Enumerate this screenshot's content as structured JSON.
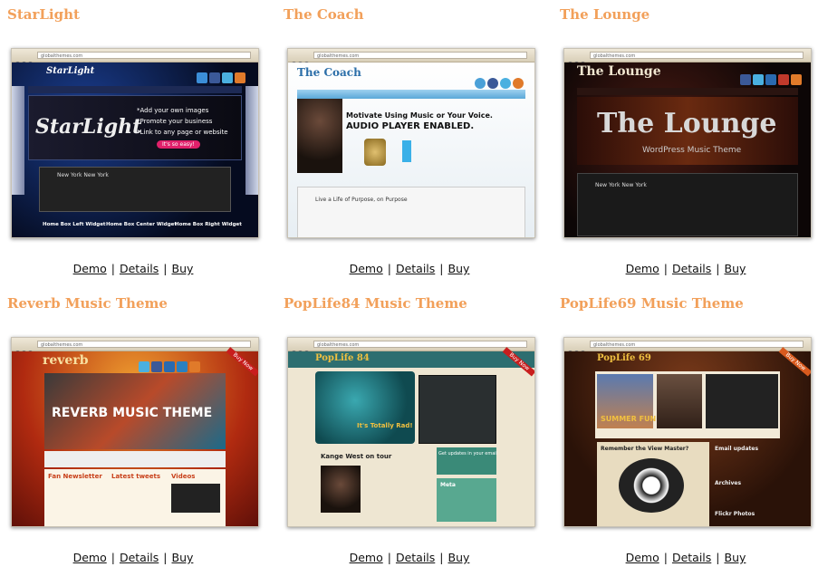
{
  "themes": [
    {
      "title": "StarLight",
      "url": "globalthemes.com",
      "demo": "Demo",
      "details": "Details",
      "buy": "Buy",
      "shot": {
        "logo": "StarLight",
        "lines": [
          "*Add your own images",
          "*Promote your business",
          "*Link to any page or website"
        ],
        "button": "It's so easy!",
        "widgets": [
          "Home Box Left Widget",
          "Home Box Center Widget",
          "Home Box Right Widget"
        ],
        "track": "New York New York"
      }
    },
    {
      "title": "The Coach",
      "url": "globalthemes.com",
      "demo": "Demo",
      "details": "Details",
      "buy": "Buy",
      "shot": {
        "logo": "The Coach",
        "headline1": "Motivate Using Music or Your Voice.",
        "headline2": "AUDIO PLAYER ENABLED.",
        "track": "Live a Life of Purpose, on Purpose"
      }
    },
    {
      "title": "The Lounge",
      "url": "globalthemes.com",
      "demo": "Demo",
      "details": "Details",
      "buy": "Buy",
      "shot": {
        "logo": "The Lounge",
        "banner1": "The Lounge",
        "banner2": "WordPress Music Theme",
        "track": "New York New York"
      }
    },
    {
      "title": "Reverb Music Theme",
      "url": "globalthemes.com",
      "demo": "Demo",
      "details": "Details",
      "buy": "Buy",
      "shot": {
        "logo": "reverb",
        "banner": "REVERB MUSIC THEME",
        "col1": "Fan Newsletter",
        "col2": "Latest tweets",
        "col3": "Videos",
        "ribbon": "Buy Now"
      }
    },
    {
      "title": "PopLife84 Music Theme",
      "url": "globalthemes.com",
      "demo": "Demo",
      "details": "Details",
      "buy": "Buy",
      "shot": {
        "logo": "PopLife 84",
        "tagline": "It's Totally Rad!",
        "post": "Kange West on tour",
        "box": "Get updates in your email",
        "meta": "Meta",
        "ribbon": "Buy Now"
      }
    },
    {
      "title": "PopLife69 Music Theme",
      "url": "globalthemes.com",
      "demo": "Demo",
      "details": "Details",
      "buy": "Buy",
      "shot": {
        "logo": "PopLife 69",
        "banner": "SUMMER FUN",
        "post": "Remember the View Master?",
        "side1": "Email updates",
        "side2": "Archives",
        "side3": "Flickr Photos",
        "ribbon": "Buy Now"
      }
    }
  ],
  "colors": {
    "title": "#f2a05a",
    "link": "#111111"
  }
}
